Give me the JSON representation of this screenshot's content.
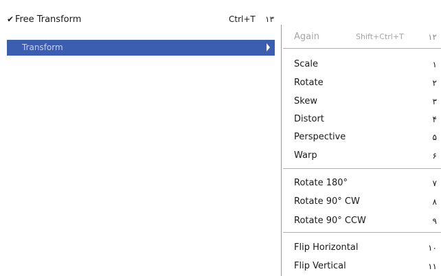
{
  "main_menu": {
    "free_transform": {
      "check": "✔",
      "label": "Free Transform",
      "shortcut": "Ctrl+T",
      "number": "۱۳"
    },
    "transform": {
      "label": "Transform"
    }
  },
  "submenu": {
    "again": {
      "label": "Again",
      "shortcut": "Shift+Ctrl+T",
      "number": "۱۲"
    },
    "items": [
      {
        "label": "Scale",
        "number": "۱"
      },
      {
        "label": "Rotate",
        "number": "۲"
      },
      {
        "label": "Skew",
        "number": "۳"
      },
      {
        "label": "Distort",
        "number": "۴"
      },
      {
        "label": "Perspective",
        "number": "۵"
      },
      {
        "label": "Warp",
        "number": "۶"
      },
      {
        "label": "Rotate 180°",
        "number": "۷"
      },
      {
        "label": "Rotate 90° CW",
        "number": "۸"
      },
      {
        "label": "Rotate 90° CCW",
        "number": "۹"
      },
      {
        "label": "Flip Horizontal",
        "number": "۱۰"
      },
      {
        "label": "Flip Vertical",
        "number": "۱۱"
      }
    ]
  },
  "colors": {
    "highlight": "#3b5eb1",
    "disabled_text": "#a5a5a5"
  }
}
